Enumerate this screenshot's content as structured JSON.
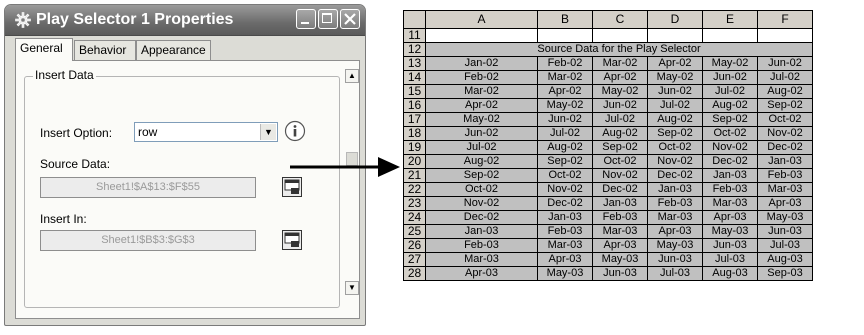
{
  "dialog": {
    "title": "Play Selector 1 Properties",
    "tabs": [
      "General",
      "Behavior",
      "Appearance"
    ],
    "group_title": "Insert Data",
    "insert_option_label": "Insert Option:",
    "insert_option_value": "row",
    "source_data_label": "Source Data:",
    "source_data_value": "Sheet1!$A$13:$F$55",
    "insert_in_label": "Insert In:",
    "insert_in_value": "Sheet1!$B$3:$G$3"
  },
  "sheet": {
    "columns": [
      "A",
      "B",
      "C",
      "D",
      "E",
      "F"
    ],
    "header_row": "11",
    "title_row_number": "12",
    "title": "Source Data for the Play Selector",
    "rows": [
      {
        "n": "13",
        "cells": [
          "Jan-02",
          "Feb-02",
          "Mar-02",
          "Apr-02",
          "May-02",
          "Jun-02"
        ]
      },
      {
        "n": "14",
        "cells": [
          "Feb-02",
          "Mar-02",
          "Apr-02",
          "May-02",
          "Jun-02",
          "Jul-02"
        ]
      },
      {
        "n": "15",
        "cells": [
          "Mar-02",
          "Apr-02",
          "May-02",
          "Jun-02",
          "Jul-02",
          "Aug-02"
        ]
      },
      {
        "n": "16",
        "cells": [
          "Apr-02",
          "May-02",
          "Jun-02",
          "Jul-02",
          "Aug-02",
          "Sep-02"
        ]
      },
      {
        "n": "17",
        "cells": [
          "May-02",
          "Jun-02",
          "Jul-02",
          "Aug-02",
          "Sep-02",
          "Oct-02"
        ]
      },
      {
        "n": "18",
        "cells": [
          "Jun-02",
          "Jul-02",
          "Aug-02",
          "Sep-02",
          "Oct-02",
          "Nov-02"
        ]
      },
      {
        "n": "19",
        "cells": [
          "Jul-02",
          "Aug-02",
          "Sep-02",
          "Oct-02",
          "Nov-02",
          "Dec-02"
        ]
      },
      {
        "n": "20",
        "cells": [
          "Aug-02",
          "Sep-02",
          "Oct-02",
          "Nov-02",
          "Dec-02",
          "Jan-03"
        ]
      },
      {
        "n": "21",
        "cells": [
          "Sep-02",
          "Oct-02",
          "Nov-02",
          "Dec-02",
          "Jan-03",
          "Feb-03"
        ]
      },
      {
        "n": "22",
        "cells": [
          "Oct-02",
          "Nov-02",
          "Dec-02",
          "Jan-03",
          "Feb-03",
          "Mar-03"
        ]
      },
      {
        "n": "23",
        "cells": [
          "Nov-02",
          "Dec-02",
          "Jan-03",
          "Feb-03",
          "Mar-03",
          "Apr-03"
        ]
      },
      {
        "n": "24",
        "cells": [
          "Dec-02",
          "Jan-03",
          "Feb-03",
          "Mar-03",
          "Apr-03",
          "May-03"
        ]
      },
      {
        "n": "25",
        "cells": [
          "Jan-03",
          "Feb-03",
          "Mar-03",
          "Apr-03",
          "May-03",
          "Jun-03"
        ]
      },
      {
        "n": "26",
        "cells": [
          "Feb-03",
          "Mar-03",
          "Apr-03",
          "May-03",
          "Jun-03",
          "Jul-03"
        ]
      },
      {
        "n": "27",
        "cells": [
          "Mar-03",
          "Apr-03",
          "May-03",
          "Jun-03",
          "Jul-03",
          "Aug-03"
        ]
      },
      {
        "n": "28",
        "cells": [
          "Apr-03",
          "May-03",
          "Jun-03",
          "Jul-03",
          "Aug-03",
          "Sep-03"
        ]
      }
    ]
  },
  "icons": {
    "title": "gear-icon",
    "minimize": "minimize-icon",
    "maximize": "maximize-icon",
    "close": "close-icon",
    "info": "info-icon",
    "range_select": "range-select-icon",
    "arrow": "arrow-right-icon"
  },
  "colors": {
    "titlebar": "#6b6b6b",
    "dialog_bg": "#dcdcd6",
    "data_cell": "#c0c0c0",
    "header_cell": "#d4d0c8"
  }
}
